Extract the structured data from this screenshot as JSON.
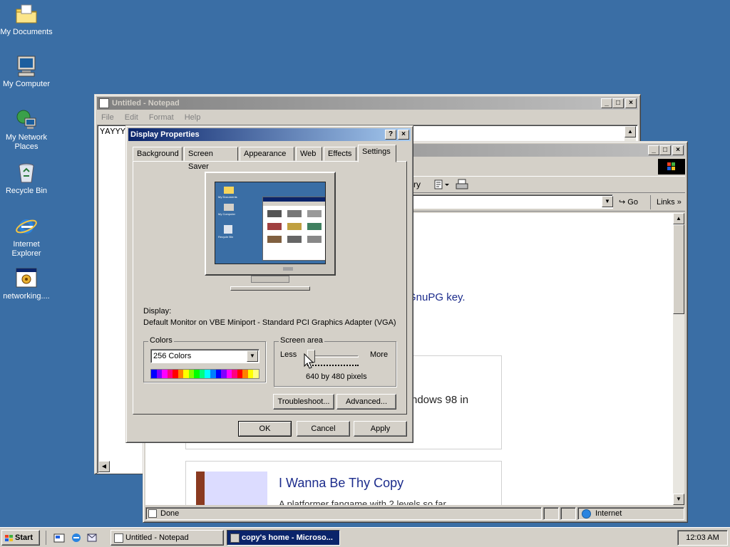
{
  "desktop": {
    "icons": [
      {
        "label": "My Documents",
        "icon": "folder-icon"
      },
      {
        "label": "My Computer",
        "icon": "computer-icon"
      },
      {
        "label": "My Network Places",
        "icon": "network-icon"
      },
      {
        "label": "Recycle Bin",
        "icon": "recycle-bin-icon"
      },
      {
        "label": "Internet Explorer",
        "icon": "ie-icon"
      },
      {
        "label": "networking....",
        "icon": "program-icon"
      }
    ]
  },
  "notepad": {
    "title": "Untitled - Notepad",
    "menu": [
      "File",
      "Edit",
      "Format",
      "Help"
    ],
    "text": "YAYYY"
  },
  "browser": {
    "address_button": "Go",
    "links_label": "Links",
    "content_fragment_1": "GnuPG key.",
    "content_fragment_2": "ndows 98 in",
    "card_title": "I Wanna Be Thy Copy",
    "card_text": "A platformer fangame with 2 levels so far",
    "toolbar_fragment": "ry",
    "status_left": "Done",
    "status_zone": "Internet"
  },
  "dialog": {
    "title": "Display Properties",
    "help_button": "?",
    "close_button": "×",
    "tabs": [
      "Background",
      "Screen Saver",
      "Appearance",
      "Web",
      "Effects",
      "Settings"
    ],
    "active_tab": "Settings",
    "preview_labels": [
      "My Documents",
      "My Computer",
      "Recycle Bin"
    ],
    "display_label": "Display:",
    "display_value": "Default Monitor on VBE Miniport - Standard PCI Graphics Adapter (VGA)",
    "colors_label": "Colors",
    "colors_value": "256 Colors",
    "screen_area_label": "Screen area",
    "less_label": "Less",
    "more_label": "More",
    "resolution": "640 by 480 pixels",
    "troubleshoot_button": "Troubleshoot...",
    "advanced_button": "Advanced...",
    "ok_button": "OK",
    "cancel_button": "Cancel",
    "apply_button": "Apply",
    "palette": [
      "#0000ff",
      "#8000ff",
      "#ff00ff",
      "#ff0080",
      "#ff0000",
      "#ff8000",
      "#ffff00",
      "#80ff00",
      "#00ff00",
      "#00ff80",
      "#00ffff",
      "#0080ff",
      "#0000ff",
      "#8000ff",
      "#ff00ff",
      "#ff0080",
      "#ff0000",
      "#ff8000",
      "#ffff00",
      "#ffff80"
    ]
  },
  "taskbar": {
    "start_label": "Start",
    "quick_launch": [
      "show-desktop-icon",
      "ie-icon",
      "outlook-icon"
    ],
    "tasks": [
      {
        "label": "Untitled - Notepad",
        "active": false
      },
      {
        "label": "copy's home - Microso...",
        "active": true
      }
    ],
    "clock": "12:03 AM"
  },
  "colors": {
    "desktop": "#3a6ea5",
    "window_face": "#d4d0c8",
    "active_title": "#0a246a",
    "link_blue": "#1c2c8c"
  }
}
